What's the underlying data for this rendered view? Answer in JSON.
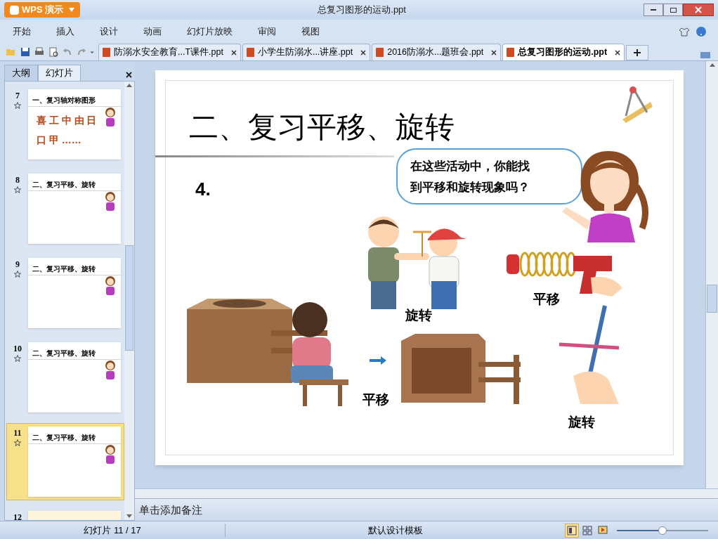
{
  "app": {
    "name": "WPS 演示"
  },
  "window": {
    "title": "总复习图形的运动.ppt"
  },
  "menu": [
    "开始",
    "插入",
    "设计",
    "动画",
    "幻灯片放映",
    "审阅",
    "视图"
  ],
  "doc_tabs": [
    {
      "label": "防溺水安全教育...T课件.ppt",
      "selected": false
    },
    {
      "label": "小学生防溺水...讲座.ppt",
      "selected": false
    },
    {
      "label": "2016防溺水...题班会.ppt",
      "selected": false
    },
    {
      "label": "总复习图形的运动.ppt",
      "selected": true
    }
  ],
  "panel": {
    "tabs": [
      {
        "label": "大纲",
        "selected": false
      },
      {
        "label": "幻灯片",
        "selected": true
      }
    ],
    "thumbnails": [
      {
        "number": "7",
        "selected": false,
        "title": "一、复习轴对称图形",
        "lines": [
          "喜 工 中 由 日",
          "口 甲 ……"
        ]
      },
      {
        "number": "8",
        "selected": false,
        "title": "二、复习平移、旋转"
      },
      {
        "number": "9",
        "selected": false,
        "title": "二、复习平移、旋转"
      },
      {
        "number": "10",
        "selected": false,
        "title": "二、复习平移、旋转"
      },
      {
        "number": "11",
        "selected": true,
        "title": "二、复习平移、旋转"
      },
      {
        "number": "12",
        "selected": false
      }
    ]
  },
  "slide": {
    "title": "二、复习平移、旋转",
    "number": "4.",
    "bubble": [
      "在这些活动中，你能找",
      "到平移和旋转现象吗？"
    ],
    "labels": [
      "旋转",
      "平移",
      "平移",
      "旋转"
    ]
  },
  "notes": {
    "placeholder": "单击添加备注"
  },
  "status_bar": {
    "slide_info": "幻灯片 11 / 17",
    "template": "默认设计模板",
    "zoom": {
      "level": 0.5
    },
    "views": [
      {
        "kind": "normal",
        "selected": true
      },
      {
        "kind": "sorter",
        "selected": false
      },
      {
        "kind": "show",
        "selected": false
      }
    ]
  }
}
